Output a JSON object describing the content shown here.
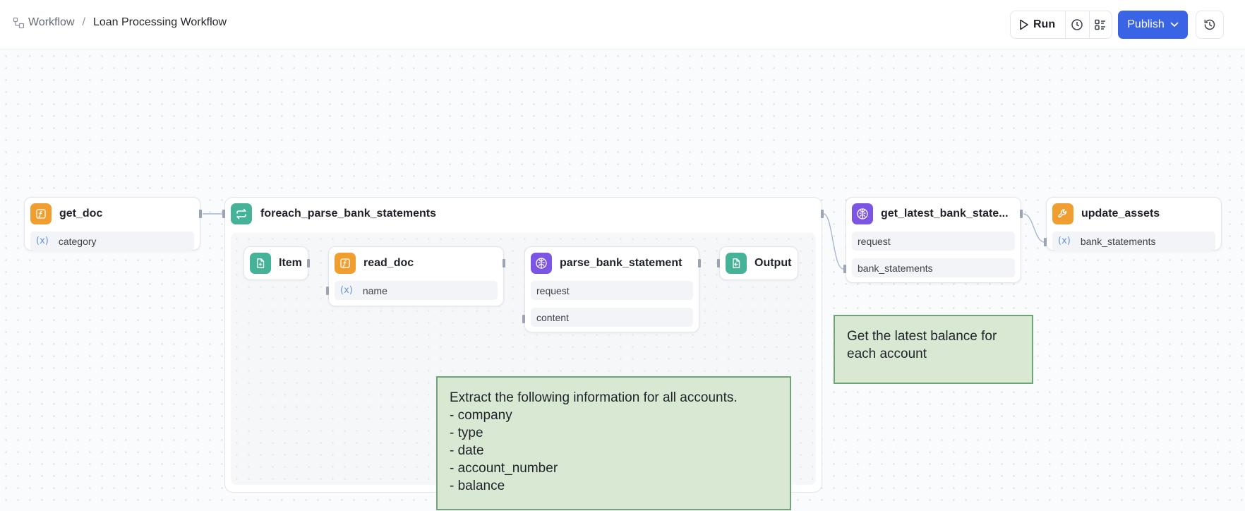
{
  "breadcrumb": {
    "root": "Workflow",
    "separator": "/",
    "current": "Loan Processing Workflow"
  },
  "toolbar": {
    "run_label": "Run",
    "publish_label": "Publish"
  },
  "colors": {
    "accent": "#3a64e6",
    "function": "#ef9e2f",
    "loop": "#46b298",
    "llm": "#7d55e3",
    "note_bg": "#d9e8d3",
    "note_border": "#6fa37a"
  },
  "nodes": {
    "get_doc": {
      "title": "get_doc",
      "icon": "function-icon",
      "fields": [
        "category"
      ]
    },
    "foreach": {
      "title": "foreach_parse_bank_statements",
      "icon": "loop-icon"
    },
    "item": {
      "title": "Item",
      "icon": "document-input-icon"
    },
    "read_doc": {
      "title": "read_doc",
      "icon": "function-icon",
      "fields": [
        "name"
      ]
    },
    "parse_bank_statement": {
      "title": "parse_bank_statement",
      "icon": "llm-brain-icon",
      "fields": [
        "request",
        "content"
      ]
    },
    "output": {
      "title": "Output",
      "icon": "document-output-icon"
    },
    "get_latest": {
      "title": "get_latest_bank_state...",
      "icon": "llm-brain-icon",
      "fields": [
        "request",
        "bank_statements"
      ]
    },
    "update_assets": {
      "title": "update_assets",
      "icon": "wrench-icon",
      "fields": [
        "bank_statements"
      ]
    }
  },
  "notes": {
    "latest_balance": [
      "Get the latest balance for",
      "each account"
    ],
    "extract": [
      "Extract the following information for all accounts.",
      "- company",
      "- type",
      "- date",
      "- account_number",
      "- balance"
    ]
  }
}
